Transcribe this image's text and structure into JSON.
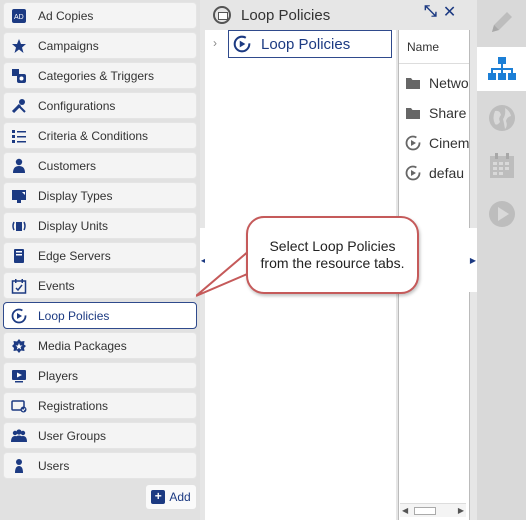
{
  "resources": [
    {
      "label": "Ad Copies",
      "icon": "ad-copies-icon"
    },
    {
      "label": "Campaigns",
      "icon": "star-icon"
    },
    {
      "label": "Categories & Triggers",
      "icon": "categories-icon"
    },
    {
      "label": "Configurations",
      "icon": "wrench-icon"
    },
    {
      "label": "Criteria & Conditions",
      "icon": "criteria-icon"
    },
    {
      "label": "Customers",
      "icon": "customer-icon"
    },
    {
      "label": "Display Types",
      "icon": "display-type-icon"
    },
    {
      "label": "Display Units",
      "icon": "display-unit-icon"
    },
    {
      "label": "Edge Servers",
      "icon": "server-icon"
    },
    {
      "label": "Events",
      "icon": "calendar-check-icon"
    },
    {
      "label": "Loop Policies",
      "icon": "loop-policy-icon",
      "selected": true
    },
    {
      "label": "Media Packages",
      "icon": "media-package-icon"
    },
    {
      "label": "Players",
      "icon": "player-icon"
    },
    {
      "label": "Registrations",
      "icon": "registration-icon"
    },
    {
      "label": "User Groups",
      "icon": "user-groups-icon"
    },
    {
      "label": "Users",
      "icon": "user-icon"
    }
  ],
  "add_button": {
    "label": "Add"
  },
  "tree": {
    "header_title": "Loop Policies",
    "node_label": "Loop Policies"
  },
  "list": {
    "column_header": "Name",
    "rows": [
      {
        "label": "Netwo",
        "icon": "folder-icon"
      },
      {
        "label": "Share",
        "icon": "folder-icon"
      },
      {
        "label": "Cinem",
        "icon": "loop-policy-icon"
      },
      {
        "label": "defau",
        "icon": "loop-policy-icon"
      }
    ]
  },
  "side_tabs": [
    {
      "name": "edit",
      "icon": "pencil-icon",
      "active": false
    },
    {
      "name": "hierarchy",
      "icon": "hierarchy-icon",
      "active": true
    },
    {
      "name": "globe",
      "icon": "globe-icon",
      "active": false
    },
    {
      "name": "calendar",
      "icon": "calendar-icon",
      "active": false
    },
    {
      "name": "play",
      "icon": "play-icon",
      "active": false
    }
  ],
  "callout": {
    "text": "Select Loop Policies from the resource tabs."
  },
  "colors": {
    "accent": "#1c3a82",
    "callout_border": "#c55a5a"
  }
}
